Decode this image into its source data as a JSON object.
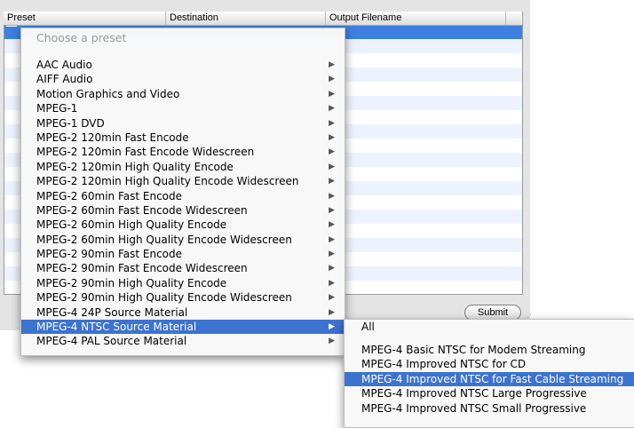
{
  "table": {
    "columns": [
      "Preset",
      "Destination",
      "Output Filename"
    ]
  },
  "submit_label": "Submit",
  "preset_menu": {
    "placeholder": "Choose a preset",
    "items": [
      "AAC Audio",
      "AIFF Audio",
      "Motion Graphics and Video",
      "MPEG-1",
      "MPEG-1 DVD",
      "MPEG-2 120min Fast Encode",
      "MPEG-2 120min Fast Encode Widescreen",
      "MPEG-2 120min High Quality Encode",
      "MPEG-2 120min High Quality Encode Widescreen",
      "MPEG-2 60min Fast Encode",
      "MPEG-2 60min Fast Encode Widescreen",
      "MPEG-2 60min High Quality Encode",
      "MPEG-2 60min High Quality Encode Widescreen",
      "MPEG-2 90min Fast Encode",
      "MPEG-2 90min Fast Encode Widescreen",
      "MPEG-2 90min High Quality Encode",
      "MPEG-2 90min High Quality Encode Widescreen",
      "MPEG-4 24P Source Material",
      "MPEG-4 NTSC Source Material",
      "MPEG-4 PAL Source Material"
    ],
    "highlighted": "MPEG-4 NTSC Source Material"
  },
  "submenu": {
    "all_label": "All",
    "items": [
      "MPEG-4 Basic NTSC for Modem Streaming",
      "MPEG-4 Improved NTSC for CD",
      "MPEG-4 Improved NTSC for Fast Cable Streaming",
      "MPEG-4 Improved NTSC Large Progressive",
      "MPEG-4 Improved NTSC Small Progressive"
    ],
    "highlighted": "MPEG-4 Improved NTSC for Fast Cable Streaming"
  },
  "icons": {
    "submenu_arrow": "submenu-arrow-icon",
    "resize": "resize-grip-icon"
  },
  "colors": {
    "highlight": "#3c73d1",
    "selected_row": "#3d80df"
  }
}
